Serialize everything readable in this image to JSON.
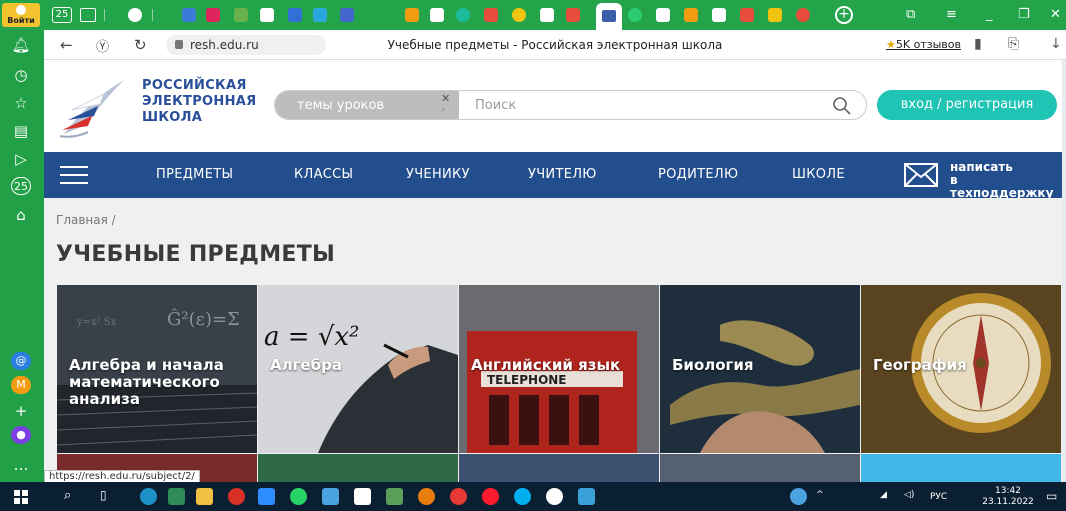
{
  "tabstrip": {
    "login_label": "Войти",
    "calendar_day": "25"
  },
  "sidepanel": {
    "calendar_day": "25"
  },
  "addressbar": {
    "url": "resh.edu.ru",
    "title": "Учебные предметы - Российская электронная школа",
    "reviews": "5K отзывов"
  },
  "site": {
    "logo_line1": "РОССИЙСКАЯ",
    "logo_line2": "ЭЛЕКТРОННАЯ",
    "logo_line3": "ШКОЛА",
    "topics_label": "темы уроков",
    "search_placeholder": "Поиск",
    "login_button": "вход / регистрация"
  },
  "nav": {
    "items": [
      "ПРЕДМЕТЫ",
      "КЛАССЫ",
      "УЧЕНИКУ",
      "УЧИТЕЛЮ",
      "РОДИТЕЛЮ",
      "ШКОЛЕ"
    ],
    "support_line1": "написать",
    "support_line2": "в техподдержку"
  },
  "content": {
    "breadcrumb": "Главная  /",
    "heading": "УЧЕБНЫЕ ПРЕДМЕТЫ",
    "subjects": [
      {
        "label_lines": [
          "Алгебра и начала",
          "математического",
          "анализа"
        ]
      },
      {
        "label_lines": [
          "Алгебра"
        ]
      },
      {
        "label_lines": [
          "Английский язык"
        ]
      },
      {
        "label_lines": [
          "Биология"
        ]
      },
      {
        "label_lines": [
          "География"
        ]
      }
    ]
  },
  "status_url": "https://resh.edu.ru/subject/2/",
  "taskbar": {
    "lang": "РУС",
    "time": "13:42",
    "date": "23.11.2022"
  },
  "colors": {
    "browser_green": "#23a34a",
    "nav_blue": "#224e8e",
    "login_teal": "#1fc4b4",
    "logo_blue": "#2a4f9a"
  }
}
